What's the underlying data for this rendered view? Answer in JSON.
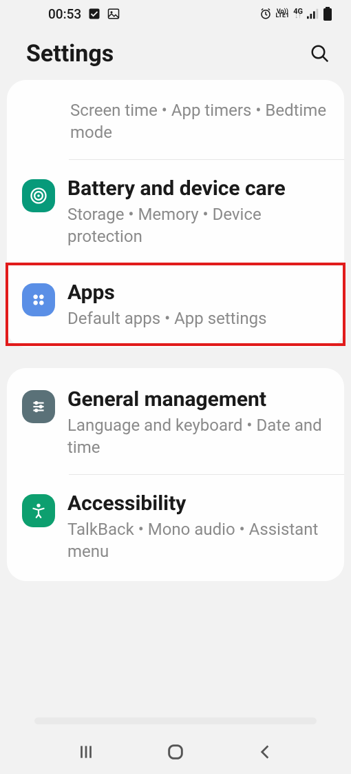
{
  "status": {
    "time": "00:53",
    "net": {
      "top": "Vo))",
      "mid": "LTE1",
      "gen": "4G"
    }
  },
  "header": {
    "title": "Settings"
  },
  "group1": {
    "prev": {
      "subtitle": "Screen time  •  App timers  •  Bedtime mode"
    },
    "battery": {
      "title": "Battery and device care",
      "subtitle": "Storage  •  Memory  •  Device protection"
    },
    "apps": {
      "title": "Apps",
      "subtitle": "Default apps  •  App settings"
    }
  },
  "group2": {
    "general": {
      "title": "General management",
      "subtitle": "Language and keyboard  •  Date and time"
    },
    "accessibility": {
      "title": "Accessibility",
      "subtitle": "TalkBack  •  Mono audio  •  Assistant menu"
    }
  }
}
